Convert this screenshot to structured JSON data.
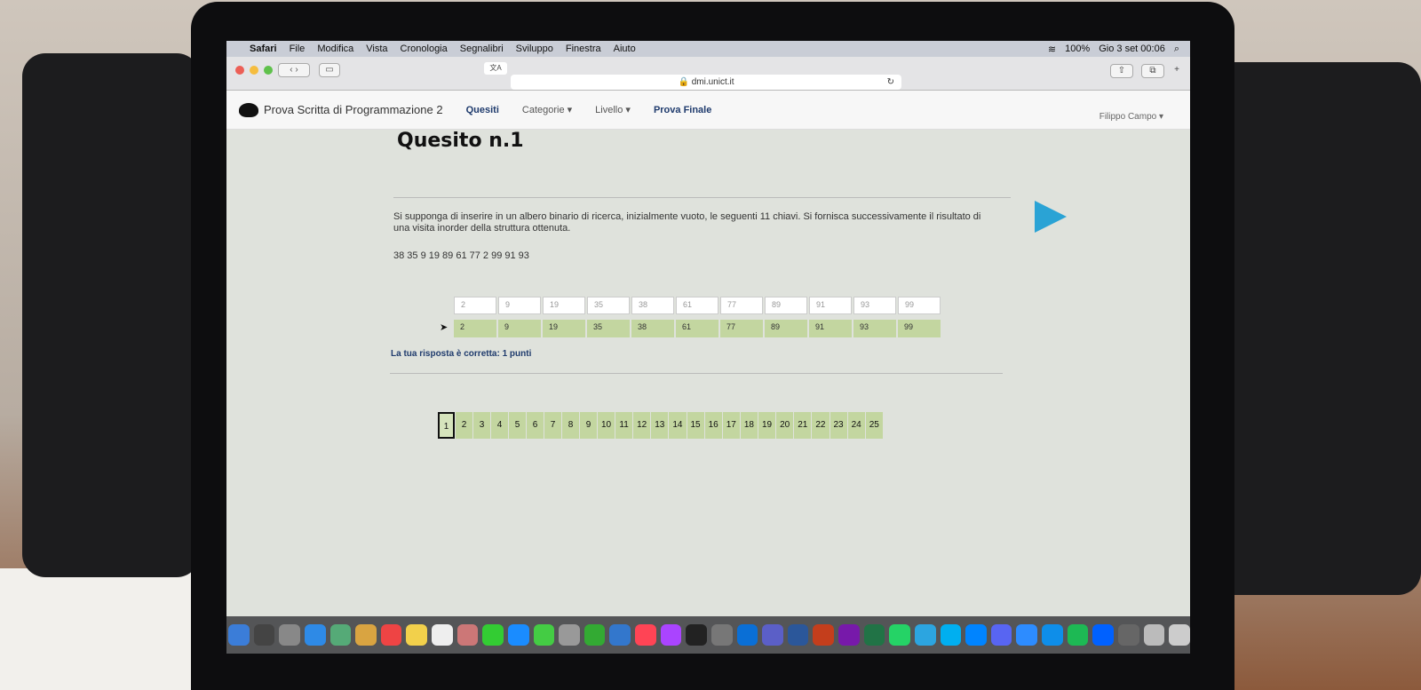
{
  "menubar": {
    "apple": "",
    "app": "Safari",
    "items": [
      "File",
      "Modifica",
      "Vista",
      "Cronologia",
      "Segnalibri",
      "Sviluppo",
      "Finestra",
      "Aiuto"
    ],
    "battery": "100%",
    "clock": "Gio 3 set  00:06"
  },
  "browser": {
    "url": "dmi.unict.it",
    "translate": "文A"
  },
  "sitenav": {
    "brand": "Prova Scritta di Programmazione 2",
    "links": [
      "Quesiti",
      "Categorie ▾",
      "Livello ▾",
      "Prova Finale"
    ],
    "user": "Filippo Campo ▾"
  },
  "page": {
    "title": "Quesito n.1",
    "question": "Si supponga di inserire in un albero binario di ricerca, inizialmente vuoto, le seguenti 11 chiavi. Si fornisca successivamente il risultato di una visita inorder della struttura ottenuta.",
    "keys": "38 35 9 19 89 61 77 2 99 91 93",
    "answer_cells": [
      "2",
      "9",
      "19",
      "35",
      "38",
      "61",
      "77",
      "89",
      "91",
      "93",
      "99"
    ],
    "solution_cells": [
      "2",
      "9",
      "19",
      "35",
      "38",
      "61",
      "77",
      "89",
      "91",
      "93",
      "99"
    ],
    "result": "La tua risposta è corretta: 1 punti",
    "pages": [
      "1",
      "2",
      "3",
      "4",
      "5",
      "6",
      "7",
      "8",
      "9",
      "10",
      "11",
      "12",
      "13",
      "14",
      "15",
      "16",
      "17",
      "18",
      "19",
      "20",
      "21",
      "22",
      "23",
      "24",
      "25"
    ],
    "current_page": "1"
  },
  "colors": {
    "correct_cell": "#c3d6a0",
    "accent_arrow": "#2aa3d5",
    "nav_active": "#1f3b6d"
  },
  "dock": {
    "icons": [
      "finder-icon",
      "siri-icon",
      "launchpad-icon",
      "safari-icon",
      "preview-icon",
      "notes-icon",
      "calendar-icon",
      "stickies-icon",
      "reminders-icon",
      "photos-icon",
      "messages-icon",
      "app-store-icon",
      "facetime-icon",
      "textedit-icon",
      "numbers-icon",
      "keynote-icon",
      "music-icon",
      "podcasts-icon",
      "tv-icon",
      "system-preferences-icon",
      "outlook-icon",
      "teams-icon",
      "word-icon",
      "powerpoint-icon",
      "onenote-icon",
      "excel-icon",
      "whatsapp-icon",
      "telegram-icon",
      "skype-icon",
      "messenger-icon",
      "discord-icon",
      "zoom-icon",
      "teamviewer-icon",
      "spotify-icon",
      "dropbox-icon",
      "bootcamp-icon",
      "finder-window-icon",
      "trash-icon"
    ]
  }
}
